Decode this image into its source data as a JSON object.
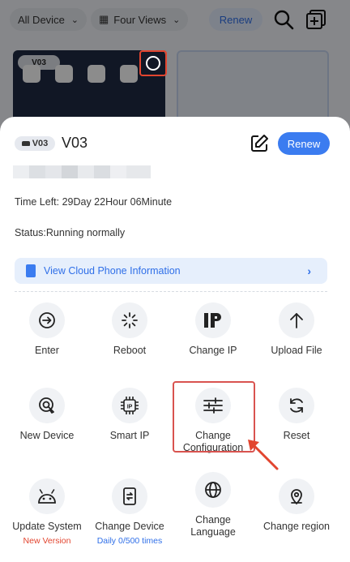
{
  "topbar": {
    "device_filter": "All Device",
    "view_mode": "Four Views",
    "renew_label": "Renew",
    "icons": [
      "chevron-down-icon",
      "grid-icon",
      "search-icon",
      "add-window-icon"
    ]
  },
  "background_card": {
    "badge": "V03"
  },
  "sheet": {
    "badge": "V03",
    "device_name": "V03",
    "renew_label": "Renew",
    "time_left": "Time Left: 29Day 22Hour 06Minute",
    "status": "Status:Running normally",
    "info_link": "View Cloud Phone Information",
    "actions": [
      {
        "label": "Enter",
        "icon": "enter-icon"
      },
      {
        "label": "Reboot",
        "icon": "reboot-icon"
      },
      {
        "label": "Change IP",
        "icon": "ip-icon"
      },
      {
        "label": "Upload File",
        "icon": "upload-icon"
      },
      {
        "label": "New Device",
        "icon": "new-device-icon"
      },
      {
        "label": "Smart IP",
        "icon": "smart-ip-icon"
      },
      {
        "label": "Change Configuration",
        "icon": "configuration-icon"
      },
      {
        "label": "Reset",
        "icon": "reset-icon"
      },
      {
        "label": "Update System",
        "icon": "android-icon",
        "sub": "New Version"
      },
      {
        "label": "Change Device",
        "icon": "change-device-icon",
        "sub": "Daily 0/500 times"
      },
      {
        "label": "Change Language",
        "icon": "globe-icon"
      },
      {
        "label": "Change region",
        "icon": "location-icon"
      }
    ]
  },
  "colors": {
    "accent": "#3b7cf0",
    "highlight": "#d9534f",
    "sub_red": "#e2452f",
    "sub_blue": "#2f6fe8"
  }
}
